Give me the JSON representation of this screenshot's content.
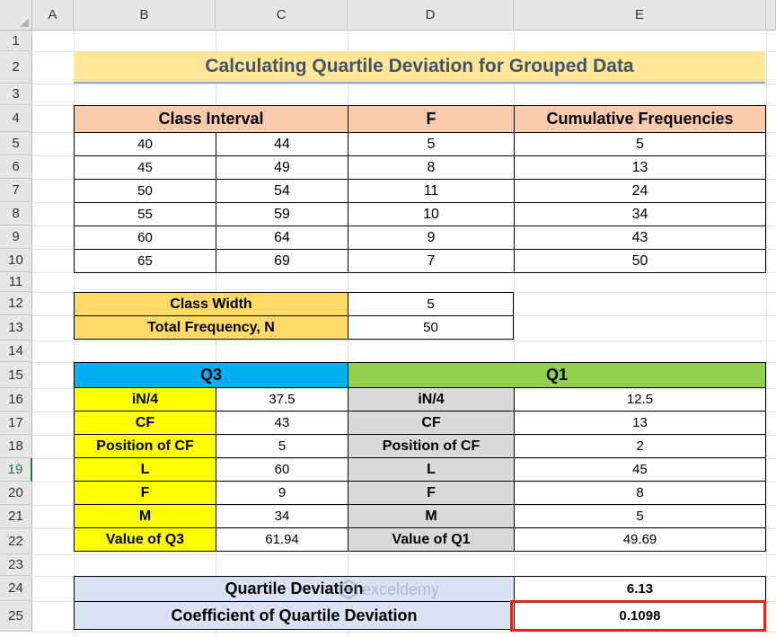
{
  "columns": [
    "A",
    "B",
    "C",
    "D",
    "E"
  ],
  "rows": [
    "1",
    "2",
    "3",
    "4",
    "5",
    "6",
    "7",
    "8",
    "9",
    "10",
    "11",
    "12",
    "13",
    "14",
    "15",
    "16",
    "17",
    "18",
    "19",
    "20",
    "21",
    "22",
    "23",
    "24",
    "25"
  ],
  "selected_row": "19",
  "title": "Calculating Quartile Deviation for Grouped Data",
  "freq_table": {
    "headers": [
      "Class Interval",
      "F",
      "Cumulative Frequencies"
    ],
    "rows": [
      {
        "lower": "40",
        "upper": "44",
        "f": "5",
        "cf": "5"
      },
      {
        "lower": "45",
        "upper": "49",
        "f": "8",
        "cf": "13"
      },
      {
        "lower": "50",
        "upper": "54",
        "f": "11",
        "cf": "24"
      },
      {
        "lower": "55",
        "upper": "59",
        "f": "10",
        "cf": "34"
      },
      {
        "lower": "60",
        "upper": "64",
        "f": "9",
        "cf": "43"
      },
      {
        "lower": "65",
        "upper": "69",
        "f": "7",
        "cf": "50"
      }
    ]
  },
  "summary": {
    "class_width_label": "Class Width",
    "class_width_value": "5",
    "total_freq_label": "Total Frequency, N",
    "total_freq_value": "50"
  },
  "quartiles": {
    "q3_header": "Q3",
    "q1_header": "Q1",
    "rows": [
      {
        "q3_label": "iN/4",
        "q3_value": "37.5",
        "q1_label": "iN/4",
        "q1_value": "12.5"
      },
      {
        "q3_label": "CF",
        "q3_value": "43",
        "q1_label": "CF",
        "q1_value": "13"
      },
      {
        "q3_label": "Position of CF",
        "q3_value": "5",
        "q1_label": "Position of CF",
        "q1_value": "2"
      },
      {
        "q3_label": "L",
        "q3_value": "60",
        "q1_label": "L",
        "q1_value": "45"
      },
      {
        "q3_label": "F",
        "q3_value": "9",
        "q1_label": "F",
        "q1_value": "8"
      },
      {
        "q3_label": "M",
        "q3_value": "34",
        "q1_label": "M",
        "q1_value": "5"
      },
      {
        "q3_label": "Value of Q3",
        "q3_value": "61.94",
        "q1_label": "Value of Q1",
        "q1_value": "49.69"
      }
    ]
  },
  "result": {
    "qd_label": "Quartile Deviation",
    "qd_value": "6.13",
    "cqd_label": "Coefficient of Quartile Deviation",
    "cqd_value": "0.1098"
  },
  "watermark": {
    "text": "exceldemy",
    "icon": "exceldemy-logo-icon"
  },
  "colors": {
    "title_fill": "#ffe699",
    "title_text": "#44546a",
    "header_peach": "#f8cbad",
    "label_gold": "#ffd966",
    "q3_blue": "#00b0f0",
    "q1_green": "#92d050",
    "q3_label_yellow": "#ffff00",
    "q1_label_grey": "#d9d9d9",
    "result_lavender": "#d9e1f2",
    "highlight_red": "#d9281e"
  }
}
